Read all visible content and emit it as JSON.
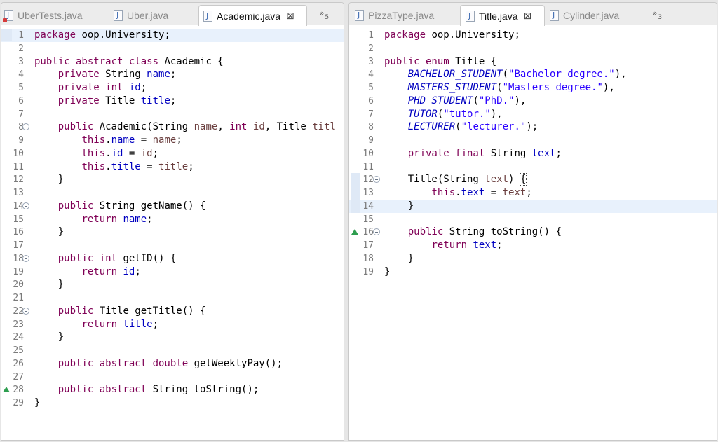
{
  "left": {
    "tabs": [
      {
        "label": "UberTests.java",
        "active": false,
        "error": true
      },
      {
        "label": "Uber.java",
        "active": false,
        "error": false
      },
      {
        "label": "Academic.java",
        "active": true,
        "error": false
      }
    ],
    "close_glyph": "⊠",
    "overflow_glyph": "»",
    "overflow_count": "5",
    "lines": [
      {
        "n": "1",
        "html": "<span class=\"kw\">package</span> oop.University;",
        "hl": true
      },
      {
        "n": "2",
        "html": ""
      },
      {
        "n": "3",
        "html": "<span class=\"kw\">public abstract class</span> Academic {"
      },
      {
        "n": "4",
        "html": "    <span class=\"kw\">private</span> String <span class=\"fld\">name</span>;"
      },
      {
        "n": "5",
        "html": "    <span class=\"kw\">private int</span> <span class=\"fld\">id</span>;"
      },
      {
        "n": "6",
        "html": "    <span class=\"kw\">private</span> Title <span class=\"fld\">title</span>;"
      },
      {
        "n": "7",
        "html": ""
      },
      {
        "n": "8",
        "html": "    <span class=\"kw\">public</span> Academic(String <span class=\"prm\">name</span>, <span class=\"kw\">int</span> <span class=\"prm\">id</span>, Title <span class=\"prm\">titl</span>",
        "fold": true
      },
      {
        "n": "9",
        "html": "        <span class=\"kw\">this</span>.<span class=\"fld\">name</span> = <span class=\"prm\">name</span>;"
      },
      {
        "n": "10",
        "html": "        <span class=\"kw\">this</span>.<span class=\"fld\">id</span> = <span class=\"prm\">id</span>;"
      },
      {
        "n": "11",
        "html": "        <span class=\"kw\">this</span>.<span class=\"fld\">title</span> = <span class=\"prm\">title</span>;"
      },
      {
        "n": "12",
        "html": "    }"
      },
      {
        "n": "13",
        "html": ""
      },
      {
        "n": "14",
        "html": "    <span class=\"kw\">public</span> String getName() {",
        "fold": true
      },
      {
        "n": "15",
        "html": "        <span class=\"kw\">return</span> <span class=\"fld\">name</span>;"
      },
      {
        "n": "16",
        "html": "    }"
      },
      {
        "n": "17",
        "html": ""
      },
      {
        "n": "18",
        "html": "    <span class=\"kw\">public int</span> getID() {",
        "fold": true
      },
      {
        "n": "19",
        "html": "        <span class=\"kw\">return</span> <span class=\"fld\">id</span>;"
      },
      {
        "n": "20",
        "html": "    }"
      },
      {
        "n": "21",
        "html": ""
      },
      {
        "n": "22",
        "html": "    <span class=\"kw\">public</span> Title getTitle() {",
        "fold": true
      },
      {
        "n": "23",
        "html": "        <span class=\"kw\">return</span> <span class=\"fld\">title</span>;"
      },
      {
        "n": "24",
        "html": "    }"
      },
      {
        "n": "25",
        "html": ""
      },
      {
        "n": "26",
        "html": "    <span class=\"kw\">public abstract double</span> getWeeklyPay();"
      },
      {
        "n": "27",
        "html": ""
      },
      {
        "n": "28",
        "html": "    <span class=\"kw\">public abstract</span> String toString();",
        "override": true
      },
      {
        "n": "29",
        "html": "}"
      }
    ]
  },
  "right": {
    "tabs": [
      {
        "label": "PizzaType.java",
        "active": false,
        "error": false
      },
      {
        "label": "Title.java",
        "active": true,
        "error": false
      },
      {
        "label": "Cylinder.java",
        "active": false,
        "error": false
      }
    ],
    "close_glyph": "⊠",
    "overflow_glyph": "»",
    "overflow_count": "3",
    "lines": [
      {
        "n": "1",
        "html": "<span class=\"kw\">package</span> oop.University;"
      },
      {
        "n": "2",
        "html": ""
      },
      {
        "n": "3",
        "html": "<span class=\"kw\">public enum</span> Title {"
      },
      {
        "n": "4",
        "html": "    <span class=\"fld it\">BACHELOR_STUDENT</span>(<span class=\"str\">\"Bachelor degree.\"</span>),"
      },
      {
        "n": "5",
        "html": "    <span class=\"fld it\">MASTERS_STUDENT</span>(<span class=\"str\">\"Masters degree.\"</span>),"
      },
      {
        "n": "6",
        "html": "    <span class=\"fld it\">PHD_STUDENT</span>(<span class=\"str\">\"PhD.\"</span>),"
      },
      {
        "n": "7",
        "html": "    <span class=\"fld it\">TUTOR</span>(<span class=\"str\">\"tutor.\"</span>),"
      },
      {
        "n": "8",
        "html": "    <span class=\"fld it\">LECTURER</span>(<span class=\"str\">\"lecturer.\"</span>);"
      },
      {
        "n": "9",
        "html": ""
      },
      {
        "n": "10",
        "html": "    <span class=\"kw\">private final</span> String <span class=\"fld\">text</span>;"
      },
      {
        "n": "11",
        "html": ""
      },
      {
        "n": "12",
        "html": "    Title(String <span class=\"prm\">text</span>) <span class=\"caretbox\">{</span>",
        "fold": true,
        "gutterhl": true
      },
      {
        "n": "13",
        "html": "        <span class=\"kw\">this</span>.<span class=\"fld\">text</span> = <span class=\"prm\">text</span>;",
        "gutterhl": true
      },
      {
        "n": "14",
        "html": "    }",
        "gutterhl": true,
        "hl": true
      },
      {
        "n": "15",
        "html": ""
      },
      {
        "n": "16",
        "html": "    <span class=\"kw\">public</span> String toString() {",
        "fold": true,
        "override": true
      },
      {
        "n": "17",
        "html": "        <span class=\"kw\">return</span> <span class=\"fld\">text</span>;"
      },
      {
        "n": "18",
        "html": "    }"
      },
      {
        "n": "19",
        "html": "}"
      }
    ]
  }
}
